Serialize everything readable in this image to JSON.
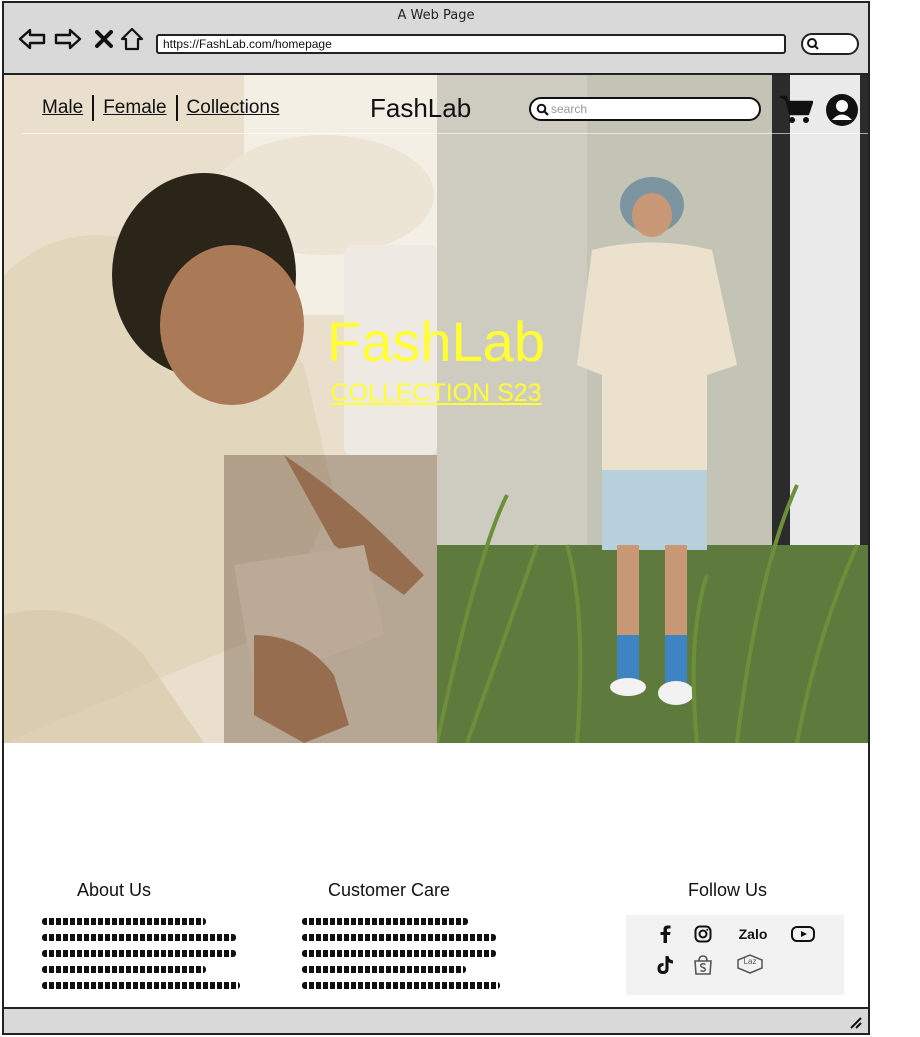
{
  "window": {
    "title": "A Web Page",
    "url": "https://FashLab.com/homepage"
  },
  "nav": {
    "links": [
      "Male",
      "Female",
      "Collections"
    ],
    "brand": "FashLab",
    "search_placeholder": "search"
  },
  "hero": {
    "title": "FashLab",
    "subtitle": "COLLECTION S23",
    "accent_color": "#ffff33"
  },
  "footer": {
    "about_title": "About Us",
    "care_title": "Customer Care",
    "follow_title": "Follow Us",
    "social": {
      "zalo_label": "Zalo",
      "lazada_label": "Laz"
    }
  }
}
